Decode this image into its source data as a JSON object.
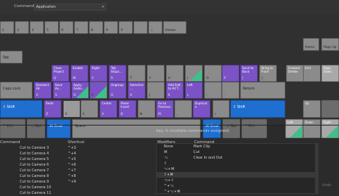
{
  "topbar": {
    "commands_label": "Commands",
    "preset_value": "Application"
  },
  "keyboard": {
    "row1": [
      {
        "label": "2"
      },
      {
        "label": "3"
      },
      {
        "label": "4"
      },
      {
        "label": "5"
      },
      {
        "label": "6"
      },
      {
        "label": "7"
      },
      {
        "label": "8"
      },
      {
        "label": "9"
      },
      {
        "label": "0"
      },
      {
        "label": "-"
      },
      {
        "label": "="
      },
      {
        "label": "Delete"
      }
    ],
    "row1_right": [
      {
        "label": "Home"
      },
      {
        "label": "Page Up"
      }
    ],
    "row2": [
      {
        "label": "Tab"
      },
      {
        "label": "Close\nProject"
      },
      {
        "label": "Enable"
      },
      {
        "label": "Right"
      },
      {
        "label": "Tab\nStops..."
      },
      {
        "label": ""
      },
      {
        "label": ""
      },
      {
        "label": ""
      },
      {
        "label": ""
      },
      {
        "label": ""
      },
      {
        "label": ""
      },
      {
        "label": "Send to\nBack"
      },
      {
        "label": "Bring to\nFront"
      }
    ],
    "row2_bottom": [
      "Q",
      "W",
      "E",
      "R",
      "T",
      "Y",
      "U",
      "I",
      "O",
      "P",
      "[",
      "]"
    ],
    "row2_right": [
      {
        "label": "Forward\nDelete"
      },
      {
        "label": "End"
      },
      {
        "label": "Page\nDown"
      }
    ],
    "row3": [
      {
        "label": "Caps Lock"
      },
      {
        "label": "Deselect\nAll"
      },
      {
        "label": "Save\nAs..."
      },
      {
        "label": "Apply\nAudio..."
      },
      {
        "label": ""
      },
      {
        "label": "Ungroup"
      },
      {
        "label": "Selection\n..."
      },
      {
        "label": ""
      },
      {
        "label": "Add Edit\nto All T..."
      },
      {
        "label": "Left"
      },
      {
        "label": ""
      },
      {
        "label": ""
      },
      {
        "label": "Return"
      }
    ],
    "row3_bottom": [
      "A",
      "S",
      "D",
      "F",
      "G",
      "H",
      "J",
      "K",
      "L",
      ";",
      "'"
    ],
    "row4": [
      {
        "label": "⇧ Shift"
      },
      {
        "label": "Redo"
      },
      {
        "label": ""
      },
      {
        "label": ""
      },
      {
        "label": "Center"
      },
      {
        "label": "Paste\nInsert"
      },
      {
        "label": ""
      },
      {
        "label": "Go to\nPrevious"
      },
      {
        "label": ""
      },
      {
        "label": "Duplicat\ne"
      },
      {
        "label": "⇧ Shift"
      }
    ],
    "row4_bottom": [
      "Z",
      "X",
      "C",
      "V",
      "B",
      "N",
      "M",
      ",",
      ".",
      "/"
    ],
    "row4_right": [
      {
        "label": "Up"
      }
    ],
    "row5": [
      {
        "label": "^ Ctrl"
      },
      {
        "label": "⌥ Opt"
      },
      {
        "label": "⌘ Cmd"
      },
      {
        "label": "Space"
      },
      {
        "label": "⌘ Cmd"
      },
      {
        "label": "⌥ Opt"
      },
      {
        "label": "^ Ctrl"
      }
    ],
    "row5_right": [
      {
        "label": "Left"
      },
      {
        "label": "Down"
      },
      {
        "label": "Right"
      }
    ]
  },
  "key_legend": "Key:  X (multiple commands assigned)",
  "commands_table": {
    "headers": {
      "command": "Command",
      "shortcut": "Shortcut"
    },
    "rows": [
      {
        "command": "Cut to Camera 3",
        "shortcut": "^+3"
      },
      {
        "command": "Cut to Camera 4",
        "shortcut": "^+4"
      },
      {
        "command": "Cut to Camera 5",
        "shortcut": "^+5"
      },
      {
        "command": "Cut to Camera 6",
        "shortcut": "^+6"
      },
      {
        "command": "Cut to Camera 7",
        "shortcut": "^+7"
      },
      {
        "command": "Cut to Camera 8",
        "shortcut": "^+8"
      },
      {
        "command": "Cut to Camera 9",
        "shortcut": "^+9"
      },
      {
        "command": "Cut to Camera 10",
        "shortcut": ""
      },
      {
        "command": "Cut to Camera 11",
        "shortcut": ""
      }
    ]
  },
  "modifiers_table": {
    "headers": {
      "modifiers": "Modifiers",
      "command": "Command"
    },
    "rows": [
      {
        "modifiers": "None",
        "command": "Mark Clip"
      },
      {
        "modifiers": "⌘",
        "command": "Cut"
      },
      {
        "modifiers": "⌥",
        "command": "Clear In and Out"
      },
      {
        "modifiers": "⇧",
        "command": ""
      },
      {
        "modifiers": "⌥+⌘",
        "command": ""
      },
      {
        "modifiers": "⇧+⌘",
        "command": ""
      },
      {
        "modifiers": "⌥+⇧",
        "command": ""
      },
      {
        "modifiers": "^+⌥",
        "command": ""
      },
      {
        "modifiers": "^+⌥+⌘",
        "command": ""
      }
    ]
  },
  "undo_label": "Undo",
  "colors": {
    "purple": "#7b53c6",
    "blue": "#1f6fd1",
    "teal": "#3fbf89"
  }
}
